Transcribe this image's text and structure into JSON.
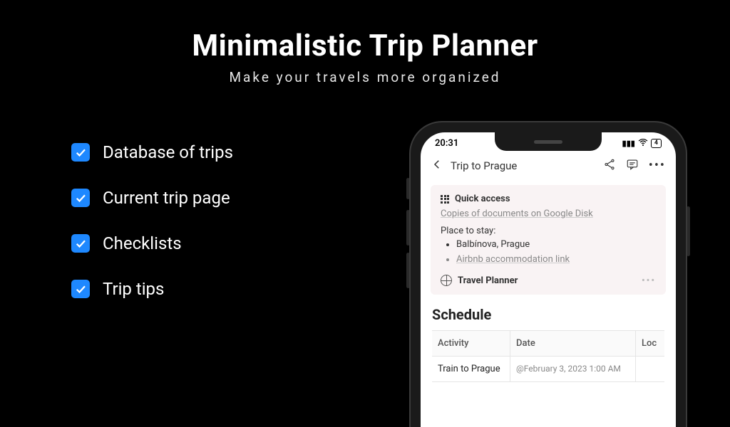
{
  "header": {
    "title": "Minimalistic Trip Planner",
    "subtitle": "Make your travels more organized"
  },
  "features": [
    "Database of trips",
    "Current trip page",
    "Checklists",
    "Trip tips"
  ],
  "phone": {
    "status": {
      "time": "20:31",
      "battery": "4"
    },
    "page_title": "Trip to Prague",
    "card": {
      "title": "Quick access",
      "doc_link": "Copies of documents on Google Disk",
      "place_label": "Place to stay:",
      "place_item": "Balbínova, Prague",
      "airbnb_link": "Airbnb accommodation link",
      "footer": "Travel Planner"
    },
    "schedule": {
      "title": "Schedule",
      "columns": {
        "activity": "Activity",
        "date": "Date",
        "loc": "Loc"
      },
      "row": {
        "activity": "Train to Prague",
        "date": "@February 3, 2023 1:00 AM"
      }
    }
  }
}
